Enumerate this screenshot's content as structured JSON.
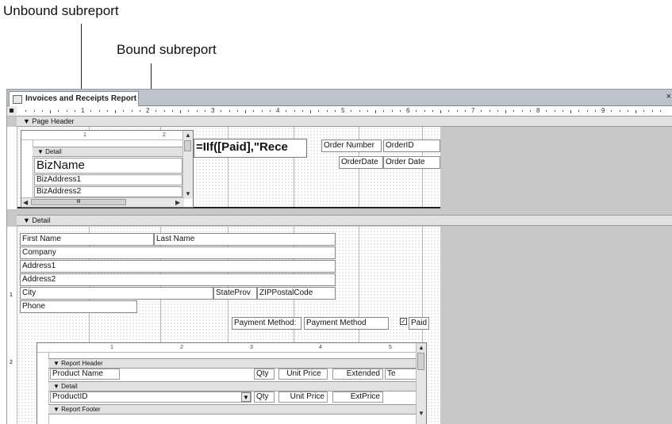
{
  "callouts": {
    "unbound": "Unbound subreport",
    "bound": "Bound subreport"
  },
  "window": {
    "tab_title": "Invoices and Receipts Report",
    "close_glyph": "×"
  },
  "ruler": {
    "numbers": [
      "1",
      "2",
      "3",
      "4",
      "5",
      "6",
      "7",
      "8",
      "9"
    ]
  },
  "sections": {
    "page_header": "Page Header",
    "detail": "Detail"
  },
  "page_header": {
    "unbound_sub": {
      "ruler_numbers": [
        "1",
        "2"
      ],
      "detail_label": "Detail",
      "fields": [
        "BizName",
        "BizAddress1",
        "BizAddress2"
      ],
      "hscroll_mid": "III"
    },
    "iif_expression": "=IIf([Paid],\"Rece",
    "order_number_label": "Order Number",
    "order_id_field": "OrderID",
    "order_date_label": "OrderDate",
    "order_date_field": "Order Date"
  },
  "detail": {
    "first_name": "First Name",
    "last_name": "Last Name",
    "company": "Company",
    "address1": "Address1",
    "address2": "Address2",
    "city": "City",
    "state": "StateProv",
    "zip": "ZIPPostalCode",
    "phone": "Phone",
    "payment_label": "Payment Method:",
    "payment_field": "Payment Method",
    "paid_label": "Paid",
    "paid_checked": true,
    "vruler_numbers": [
      "1",
      "2"
    ]
  },
  "bound_sub": {
    "ruler_numbers": [
      "1",
      "2",
      "3",
      "4",
      "5"
    ],
    "report_header": "Report Header",
    "detail": "Detail",
    "report_footer": "Report Footer",
    "header_fields": [
      "Product Name",
      "Qty",
      "Unit Price",
      "Extended",
      "Te"
    ],
    "detail_fields": [
      "ProductID",
      "Qty",
      "Unit Price",
      "ExtPrice"
    ]
  },
  "icons": {
    "section_glyph": "section-arrow-icon",
    "check_glyph": "checkbox-checked-icon"
  }
}
